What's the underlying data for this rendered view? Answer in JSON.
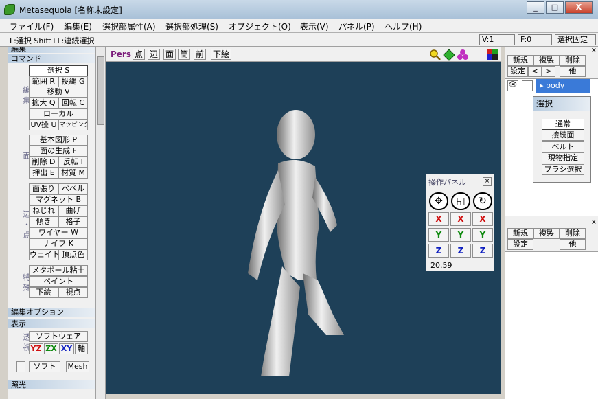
{
  "window": {
    "title": "Metasequoia [名称未設定]",
    "minimize": "_",
    "maximize": "□",
    "close": "X"
  },
  "menu": [
    "ファイル(F)",
    "編集(E)",
    "選択部属性(A)",
    "選択部処理(S)",
    "オブジェクト(O)",
    "表示(V)",
    "パネル(P)",
    "ヘルプ(H)"
  ],
  "status": {
    "hint": "L:選択 Shift+L:連続選択",
    "vertex": "V:1",
    "face": "F:0",
    "mode": "選択固定"
  },
  "left": {
    "cut_header": "編集",
    "command_header": "コマンド",
    "edit_group": "編集",
    "face_group": "面",
    "edge_group": "辺・点",
    "special_group": "特殊",
    "select": "選択 S",
    "range": "範囲 R",
    "lasso": "投縄 G",
    "move": "移動 V",
    "scale": "拡大 Q",
    "rotate": "回転 C",
    "local": "ローカル",
    "uv": "UV操 U",
    "mapping": "マッピング",
    "primitive": "基本図形 P",
    "create_face": "面の生成 F",
    "delete": "削除 D",
    "flip": "反転 I",
    "extrude": "押出 E",
    "material": "材質 M",
    "face_stretch": "面張り",
    "bevel": "ベベル",
    "magnet": "マグネット B",
    "twist": "ねじれ",
    "bend": "曲げ",
    "tilt": "傾き",
    "lattice": "格子",
    "wire": "ワイヤー W",
    "knife": "ナイフ K",
    "weight": "ウェイト",
    "vertex_color": "頂点色",
    "metaball": "メタボール粘土",
    "paint": "ペイント",
    "underlay": "下絵",
    "viewpoint": "視点",
    "edit_option_header": "編集オプション",
    "display_header": "表示",
    "display_group": "透視",
    "software": "ソフトウェア",
    "yz": "YZ",
    "zx": "ZX",
    "xy": "XY",
    "axis": "軸",
    "soft": "ソフト",
    "mesh": "Mesh",
    "lighting_header": "照光"
  },
  "viewport": {
    "mode": "Pers",
    "tabs": [
      "点",
      "辺",
      "面",
      "簡",
      "前"
    ],
    "underlay": "下絵"
  },
  "right": {
    "new": "新規",
    "duplicate": "複製",
    "remove": "削除",
    "settings": "設定",
    "up": "<",
    "down": ">",
    "other": "他",
    "object_name": "body",
    "new2": "新規",
    "duplicate2": "複製",
    "remove2": "削除",
    "settings2": "設定",
    "other2": "他"
  },
  "select_panel": {
    "title": "選択",
    "normal": "通常",
    "connected": "接続面",
    "belt": "ベルト",
    "current": "現物指定",
    "brush": "ブラシ選択"
  },
  "ops_panel": {
    "title": "操作パネル",
    "x": "X",
    "y": "Y",
    "z": "Z",
    "value": "20.59"
  },
  "colors": {
    "viewport_bg": "#1e4058",
    "x_axis": "#d01010",
    "y_axis": "#108a10",
    "z_axis": "#1020c0",
    "selected_object": "#3a7ad8"
  }
}
